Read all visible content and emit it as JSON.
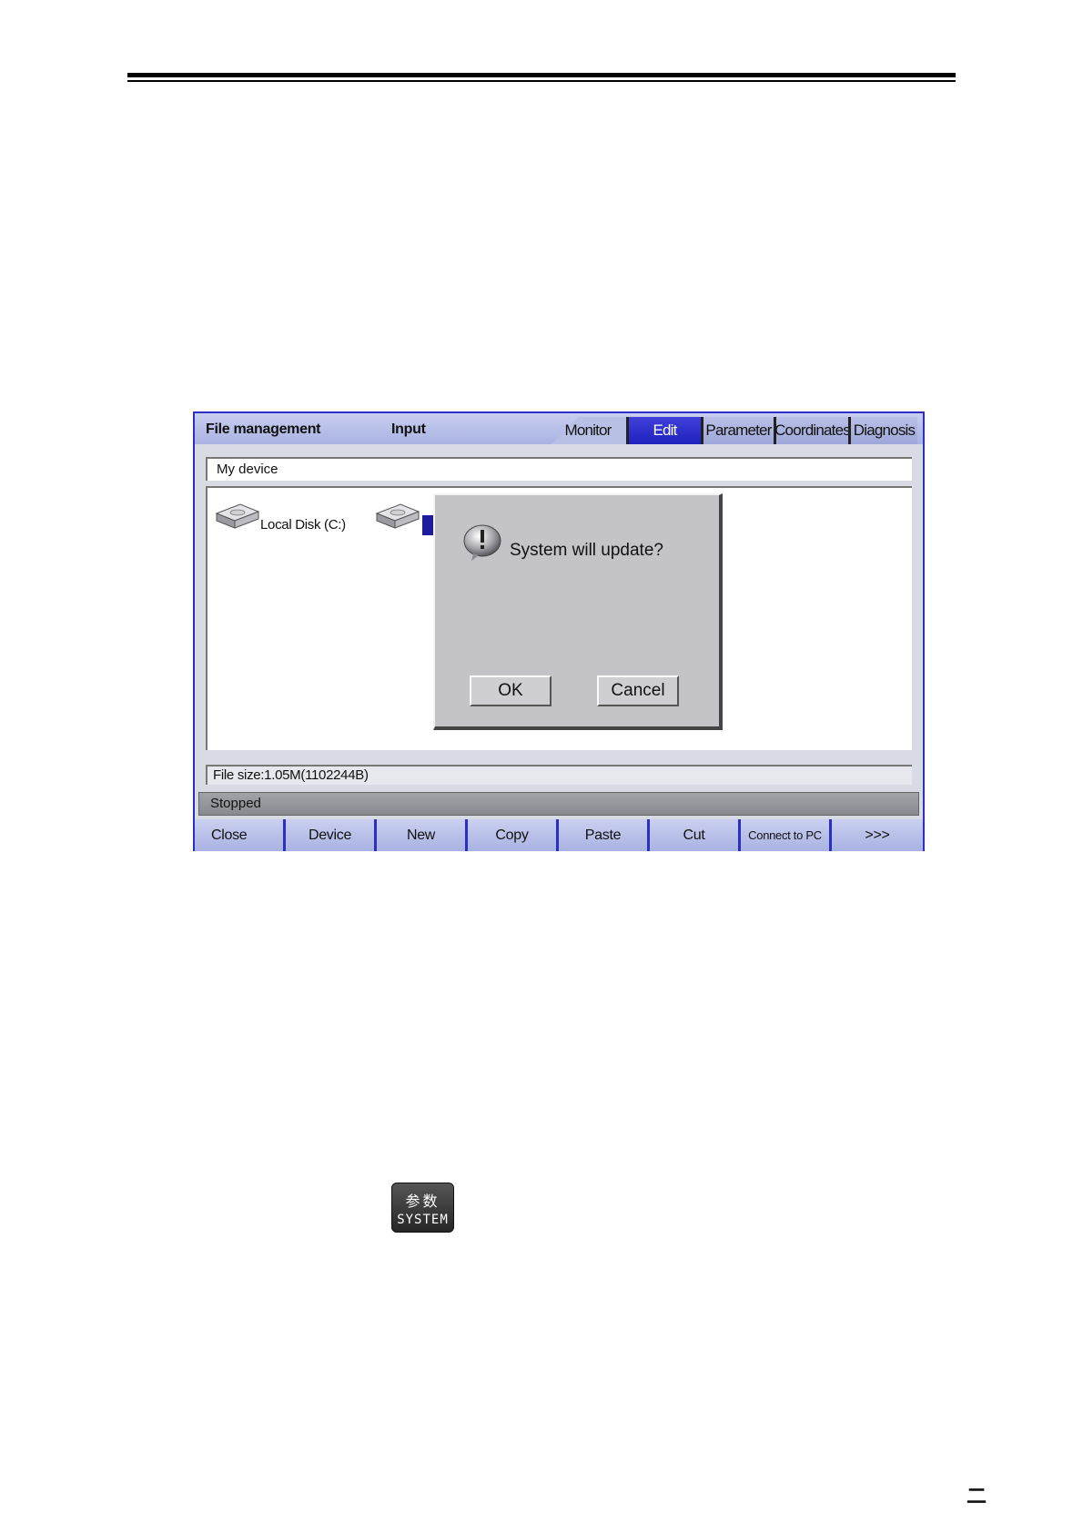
{
  "window": {
    "mode_title": "File management",
    "input_label": "Input",
    "tabs": [
      {
        "label": "Monitor",
        "active": false
      },
      {
        "label": "Edit",
        "active": true
      },
      {
        "label": "Parameter",
        "active": false
      },
      {
        "label": "Coordinates",
        "active": false
      },
      {
        "label": "Diagnosis",
        "active": false
      }
    ],
    "path": "My device",
    "disks": [
      {
        "label": "Local Disk (C:)"
      }
    ],
    "file_size": "File size:1.05M(1102244B)",
    "status": "Stopped",
    "softkeys": [
      "Close",
      "Device",
      "New",
      "Copy",
      "Paste",
      "Cut",
      "Connect to PC",
      ">>>"
    ]
  },
  "dialog": {
    "message": "System will update?",
    "ok_label": "OK",
    "cancel_label": "Cancel",
    "icon": "warning-icon"
  },
  "system_key": {
    "label_cn": "参数",
    "label_en": "SYSTEM"
  },
  "page_mark": "二",
  "colors": {
    "frame_blue": "#2f2ec4",
    "active_tab": "#2528c4"
  }
}
